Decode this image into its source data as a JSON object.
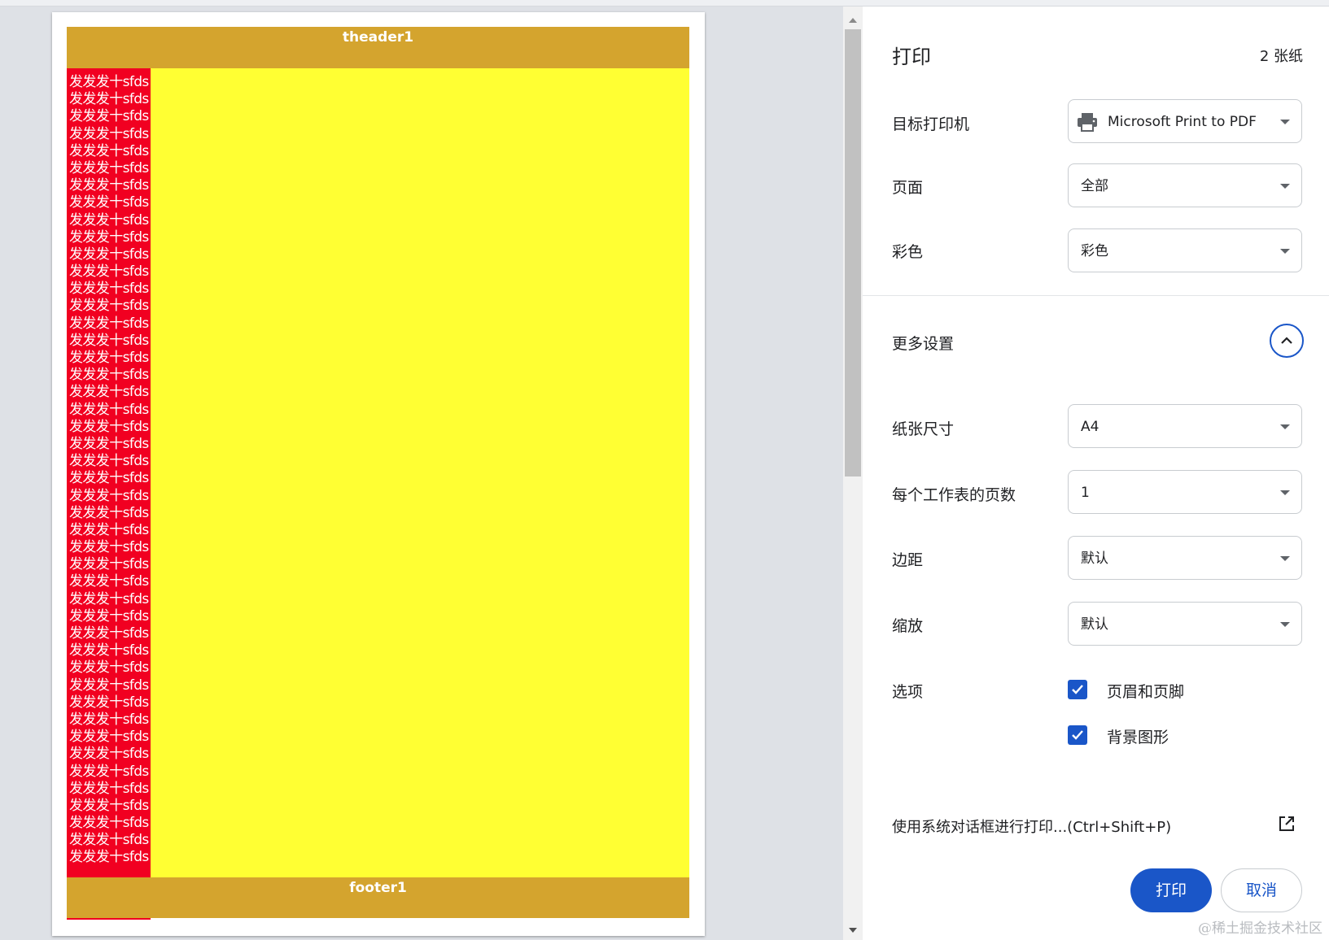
{
  "preview": {
    "header_text": "theader1",
    "footer_text": "footer1",
    "rows": [
      "发发发十sfds",
      "发发发十sfds",
      "发发发十sfds",
      "发发发十sfds",
      "发发发十sfds",
      "发发发十sfds",
      "发发发十sfds",
      "发发发十sfds",
      "发发发十sfds",
      "发发发十sfds",
      "发发发十sfds",
      "发发发十sfds",
      "发发发十sfds",
      "发发发十sfds",
      "发发发十sfds",
      "发发发十sfds",
      "发发发十sfds",
      "发发发十sfds",
      "发发发十sfds",
      "发发发十sfds",
      "发发发十sfds",
      "发发发十sfds",
      "发发发十sfds",
      "发发发十sfds",
      "发发发十sfds",
      "发发发十sfds",
      "发发发十sfds",
      "发发发十sfds",
      "发发发十sfds",
      "发发发十sfds",
      "发发发十sfds",
      "发发发十sfds",
      "发发发十sfds",
      "发发发十sfds",
      "发发发十sfds",
      "发发发十sfds",
      "发发发十sfds",
      "发发发十sfds",
      "发发发十sfds",
      "发发发十sfds",
      "发发发十sfds",
      "发发发十sfds",
      "发发发十sfds",
      "发发发十sfds",
      "发发发十sfds",
      "发发发十sfds"
    ],
    "colors": {
      "header_footer": "#d4a42e",
      "content": "#ffff33",
      "column": "#f10021"
    }
  },
  "panel": {
    "title": "打印",
    "sheet_count": "2 张纸",
    "destination": {
      "label": "目标打印机",
      "value": "Microsoft Print to PDF",
      "icon": "printer-icon"
    },
    "pages": {
      "label": "页面",
      "value": "全部"
    },
    "color": {
      "label": "彩色",
      "value": "彩色"
    },
    "more_settings": {
      "label": "更多设置",
      "icon": "chevron-up-icon"
    },
    "paper_size": {
      "label": "纸张尺寸",
      "value": "A4"
    },
    "pages_per_sheet": {
      "label": "每个工作表的页数",
      "value": "1"
    },
    "margins": {
      "label": "边距",
      "value": "默认"
    },
    "scale": {
      "label": "缩放",
      "value": "默认"
    },
    "options": {
      "label": "选项",
      "headers_footers": {
        "label": "页眉和页脚",
        "checked": true
      },
      "background_graphics": {
        "label": "背景图形",
        "checked": true
      }
    },
    "system_dialog": {
      "label": "使用系统对话框进行打印...(Ctrl+Shift+P)",
      "icon": "open-external-icon"
    },
    "print_button": "打印",
    "cancel_button": "取消",
    "accent_color": "#1a56c8"
  },
  "watermark": "@稀土掘金技术社区"
}
